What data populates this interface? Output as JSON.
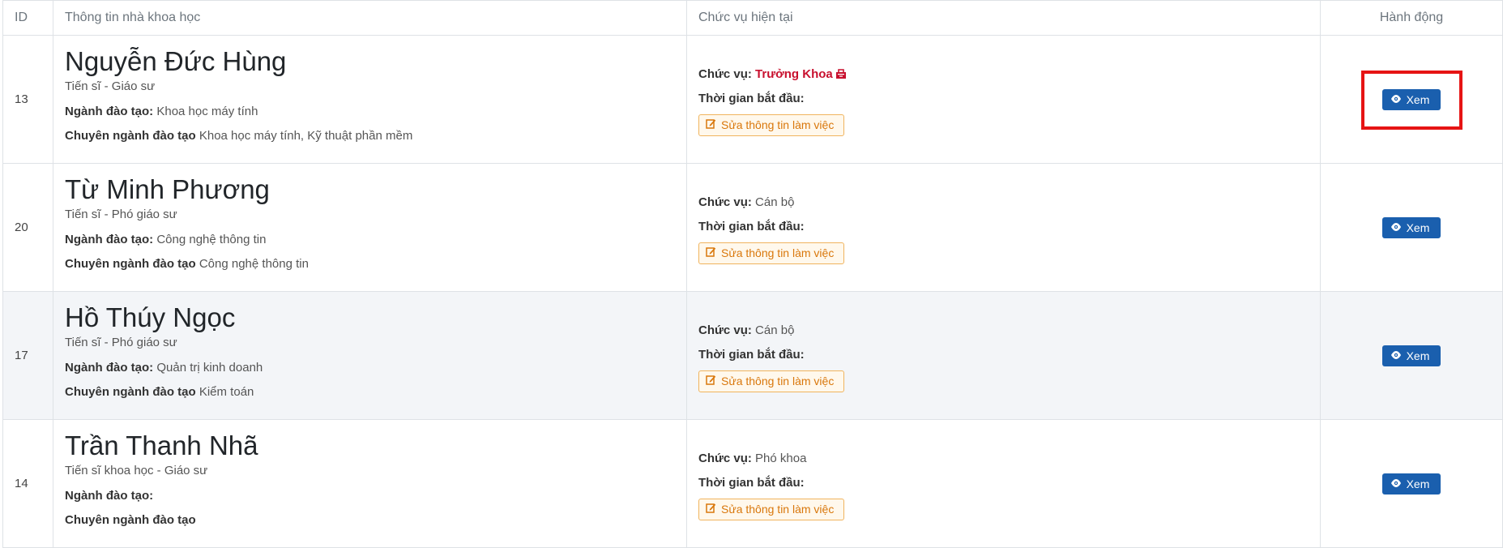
{
  "headers": {
    "id": "ID",
    "info": "Thông tin nhà khoa học",
    "position": "Chức vụ hiện tại",
    "action": "Hành động"
  },
  "labels": {
    "major": "Ngành đào tạo:",
    "specialty": "Chuyên ngành đào tạo",
    "position": "Chức vụ:",
    "start_time": "Thời gian bắt đầu:",
    "edit_button": "Sửa thông tin làm việc",
    "view_button": "Xem"
  },
  "rows": [
    {
      "id": "13",
      "name": "Nguyễn Đức Hùng",
      "degree": "Tiến sĩ - Giáo sư",
      "major": "Khoa học máy tính",
      "specialty": "Khoa học máy tính, Kỹ thuật phần mềm",
      "position": "Trưởng Khoa",
      "position_highlight": true
    },
    {
      "id": "20",
      "name": "Từ Minh Phương",
      "degree": "Tiến sĩ - Phó giáo sư",
      "major": "Công nghệ thông tin",
      "specialty": "Công nghệ thông tin",
      "position": "Cán bộ",
      "position_highlight": false
    },
    {
      "id": "17",
      "name": "Hồ Thúy Ngọc",
      "degree": "Tiến sĩ - Phó giáo sư",
      "major": "Quản trị kinh doanh",
      "specialty": "Kiểm toán",
      "position": "Cán bộ",
      "position_highlight": false
    },
    {
      "id": "14",
      "name": "Trần Thanh Nhã",
      "degree": "Tiến sĩ khoa học - Giáo sư",
      "major": "",
      "specialty": "",
      "position": "Phó khoa",
      "position_highlight": false
    }
  ],
  "colors": {
    "primary_button": "#1a5fae",
    "edit_button_text": "#d9770b",
    "position_highlight": "#c8102e",
    "annotation_box": "#e61414"
  },
  "annotation": {
    "highlighted_row_index": 0
  }
}
